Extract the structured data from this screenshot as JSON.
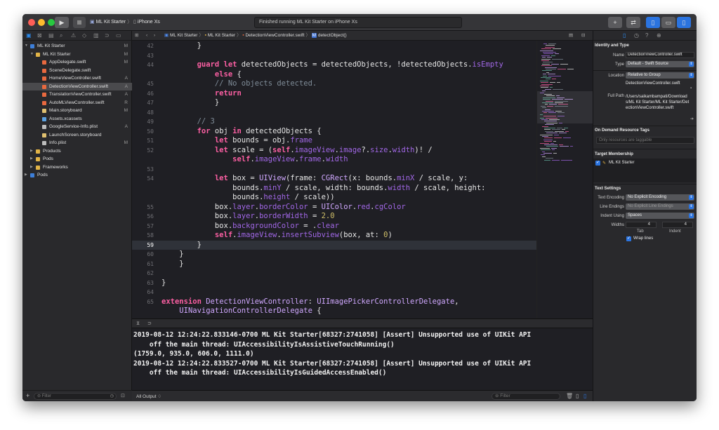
{
  "toolbar": {
    "run_icon": "play-icon",
    "stop_icon": "stop-icon",
    "scheme": "ML Kit Starter",
    "device": "iPhone Xs",
    "status": "Finished running ML Kit Starter on iPhone Xs",
    "colors": {
      "close": "#fe5f57",
      "minimize": "#febc2e",
      "zoom": "#28c840",
      "accent": "#2b74e0"
    }
  },
  "navigator": {
    "tabs": [
      "folder-icon",
      "source-control-icon",
      "symbol-icon",
      "find-icon",
      "issue-icon",
      "test-icon",
      "debug-icon",
      "breakpoint-icon",
      "report-icon"
    ],
    "items": [
      {
        "label": "ML Kit Starter",
        "badge": "M"
      },
      {
        "label": "ML Kit Starter",
        "badge": "M"
      },
      {
        "label": "AppDelegate.swift",
        "badge": "M"
      },
      {
        "label": "SceneDelegate.swift",
        "badge": ""
      },
      {
        "label": "HomeViewController.swift",
        "badge": "A"
      },
      {
        "label": "DetectionViewController.swift",
        "badge": "A"
      },
      {
        "label": "TranslationViewController.swift",
        "badge": "A"
      },
      {
        "label": "AutoMLViewController.swift",
        "badge": "R"
      },
      {
        "label": "Main.storyboard",
        "badge": "M"
      },
      {
        "label": "Assets.xcassets",
        "badge": ""
      },
      {
        "label": "GoogleService-Info.plist",
        "badge": "A"
      },
      {
        "label": "LaunchScreen.storyboard",
        "badge": ""
      },
      {
        "label": "Info.plist",
        "badge": "M"
      },
      {
        "label": "Products",
        "badge": ""
      },
      {
        "label": "Pods",
        "badge": ""
      },
      {
        "label": "Frameworks",
        "badge": ""
      },
      {
        "label": "Pods",
        "badge": ""
      }
    ],
    "filter_placeholder": "Filter"
  },
  "editor": {
    "jump_bar": [
      "ML Kit Starter",
      "ML Kit Starter",
      "DetectionViewController.swift",
      "detectObject()"
    ],
    "current_line": "59",
    "lines": [
      {
        "n": "42",
        "code": "        }"
      },
      {
        "n": "43",
        "code": ""
      },
      {
        "n": "44",
        "code": "        guard let detectedObjects = detectedObjects, !detectedObjects.isEmpty"
      },
      {
        "n": "",
        "code": "            else {"
      },
      {
        "n": "45",
        "code": "            // No objects detected."
      },
      {
        "n": "46",
        "code": "            return"
      },
      {
        "n": "47",
        "code": "            }"
      },
      {
        "n": "48",
        "code": ""
      },
      {
        "n": "49",
        "code": "        // 3"
      },
      {
        "n": "50",
        "code": "        for obj in detectedObjects {"
      },
      {
        "n": "51",
        "code": "            let bounds = obj.frame"
      },
      {
        "n": "52",
        "code": "            let scale = (self.imageView.image?.size.width)! /"
      },
      {
        "n": "",
        "code": "                self.imageView.frame.width"
      },
      {
        "n": "53",
        "code": ""
      },
      {
        "n": "54",
        "code": "            let box = UIView(frame: CGRect(x: bounds.minX / scale, y:"
      },
      {
        "n": "",
        "code": "                bounds.minY / scale, width: bounds.width / scale, height:"
      },
      {
        "n": "",
        "code": "                bounds.height / scale))"
      },
      {
        "n": "55",
        "code": "            box.layer.borderColor = UIColor.red.cgColor"
      },
      {
        "n": "56",
        "code": "            box.layer.borderWidth = 2.0"
      },
      {
        "n": "57",
        "code": "            box.backgroundColor = .clear"
      },
      {
        "n": "58",
        "code": "            self.imageView.insertSubview(box, at: 0)"
      },
      {
        "n": "59",
        "code": "        }"
      },
      {
        "n": "60",
        "code": "    }"
      },
      {
        "n": "61",
        "code": "    }"
      },
      {
        "n": "62",
        "code": ""
      },
      {
        "n": "63",
        "code": "}"
      },
      {
        "n": "64",
        "code": ""
      },
      {
        "n": "65",
        "code": "extension DetectionViewController: UIImagePickerControllerDelegate,"
      },
      {
        "n": "",
        "code": "    UINavigationControllerDelegate {"
      }
    ]
  },
  "console": {
    "lines": [
      "2019-08-12 12:24:22.833146-0700 ML Kit Starter[68327:2741058] [Assert] Unsupported use of UIKit API",
      "    off the main thread: UIAccessibilityIsAssistiveTouchRunning()",
      "(1759.0, 935.0, 606.0, 1111.0)",
      "2019-08-12 12:24:22.833527-0700 ML Kit Starter[68327:2741058] [Assert] Unsupported use of UIKit API",
      "    off the main thread: UIAccessibilityIsGuidedAccessEnabled()"
    ],
    "output_selector": "All Output ♢",
    "filter_placeholder": "Filter"
  },
  "inspector": {
    "identity_header": "Identity and Type",
    "name_label": "Name",
    "name_value": "DetectionViewController.swift",
    "type_label": "Type",
    "type_value": "Default - Swift Source",
    "location_label": "Location",
    "location_value": "Relative to Group",
    "location_file": "DetectionViewController.swift",
    "fullpath_label": "Full Path",
    "fullpath_value": "/Users/saikambampati/Downloads/ML Kit Starter/ML Kit Starter/DetectionViewController.swift",
    "odr_header": "On Demand Resource Tags",
    "odr_placeholder": "Only resources are taggable",
    "target_header": "Target Membership",
    "target_item": "ML Kit Starter",
    "text_header": "Text Settings",
    "encoding_label": "Text Encoding",
    "encoding_value": "No Explicit Encoding",
    "line_endings_label": "Line Endings",
    "line_endings_value": "No Explicit Line Endings",
    "indent_label": "Indent Using",
    "indent_value": "Spaces",
    "widths_label": "Widths",
    "tab_width": "4",
    "indent_width": "4",
    "tab_label": "Tab",
    "indent_sub_label": "Indent",
    "wrap_label": "Wrap lines"
  }
}
